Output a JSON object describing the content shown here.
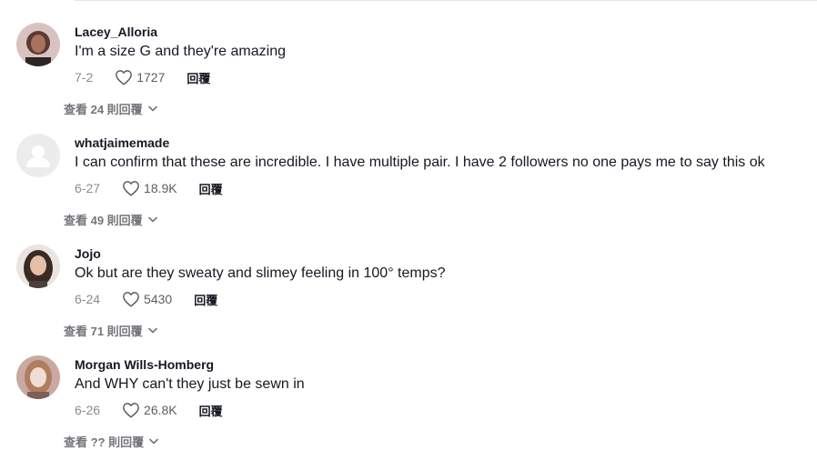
{
  "comments": [
    {
      "username": "Lacey_Alloria",
      "text": "I'm a size G and they're amazing",
      "date": "7-2",
      "likes": "1727",
      "reply_label": "回覆",
      "view_replies": "查看 24 則回覆",
      "avatar": "photo"
    },
    {
      "username": "whatjaimemade",
      "text": "I can confirm that these are incredible. I have multiple pair. I have 2 followers no one pays me to say this ok",
      "date": "6-27",
      "likes": "18.9K",
      "reply_label": "回覆",
      "view_replies": "查看 49 則回覆",
      "avatar": "default-person"
    },
    {
      "username": "Jojo",
      "text": "Ok but are they sweaty and slimey feeling in 100° temps?",
      "date": "6-24",
      "likes": "5430",
      "reply_label": "回覆",
      "view_replies": "查看 71 則回覆",
      "avatar": "photo"
    },
    {
      "username": "Morgan Wills-Homberg",
      "text": "And WHY can't they just be sewn in",
      "date": "6-26",
      "likes": "26.8K",
      "reply_label": "回覆",
      "view_replies": "查看 ?? 則回覆",
      "avatar": "photo"
    }
  ],
  "icons": {
    "like": "heart-outline-icon",
    "expand": "chevron-down-icon"
  },
  "colors": {
    "text": "#161823",
    "secondary": "#8a8b91",
    "view_replies": "#75767b"
  }
}
